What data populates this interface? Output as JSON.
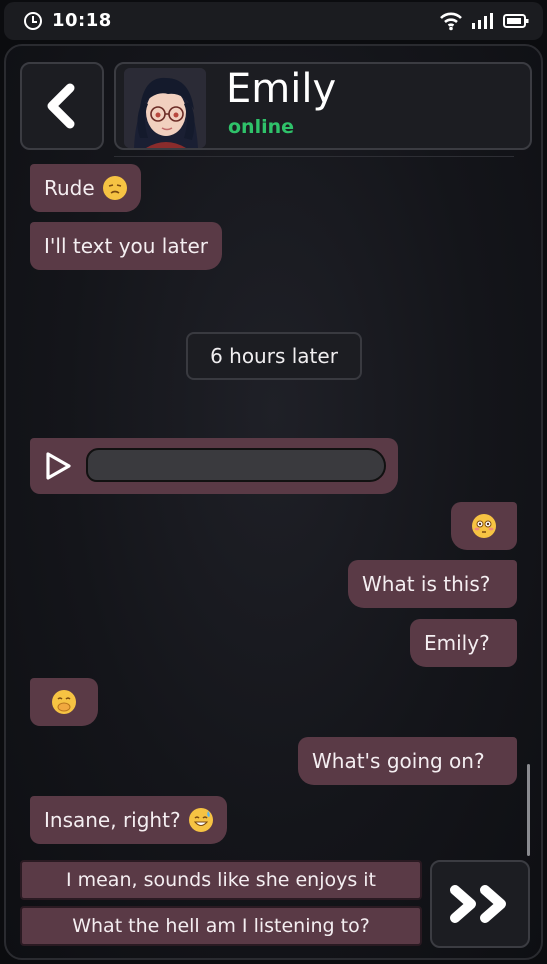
{
  "status_bar": {
    "time": "10:18",
    "icons": [
      "alarm-icon",
      "wifi-icon",
      "signal-icon",
      "battery-icon"
    ]
  },
  "header": {
    "back_icon": "chevron-left-icon",
    "contact_name": "Emily",
    "contact_status": "online"
  },
  "messages": [
    {
      "side": "in",
      "text": "Rude",
      "emoji": "unamused-face"
    },
    {
      "side": "in",
      "text": "I'll text you later"
    },
    {
      "side": "system",
      "text": "6 hours later"
    },
    {
      "side": "in",
      "type": "voice"
    },
    {
      "side": "out",
      "text": "",
      "emoji": "flushed-face"
    },
    {
      "side": "out",
      "text": "What is this?"
    },
    {
      "side": "out",
      "text": "Emily?"
    },
    {
      "side": "in",
      "text": "",
      "emoji": "hand-over-mouth-face"
    },
    {
      "side": "out",
      "text": "What's going on?"
    },
    {
      "side": "in",
      "text": "Insane, right?",
      "emoji": "grinning-sweat-face"
    }
  ],
  "choices": [
    "I mean, sounds like she enjoys it",
    "What the hell am I listening to?"
  ],
  "skip_icon": "double-chevron-right-icon",
  "colors": {
    "bubble": "#5a3a46",
    "online": "#2fc26a",
    "panel": "#1c1d22"
  }
}
